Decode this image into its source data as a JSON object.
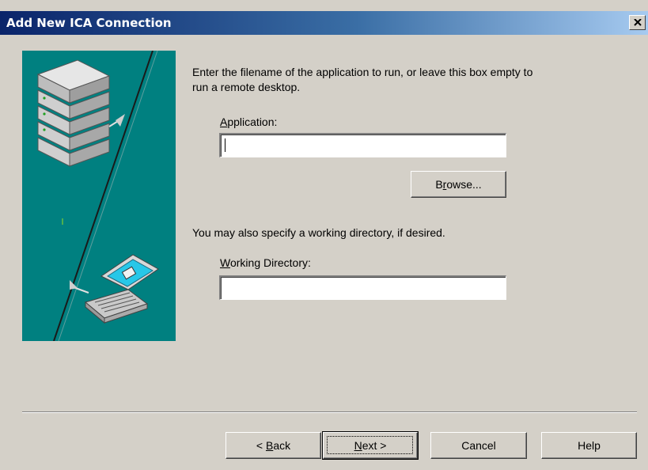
{
  "window": {
    "title": "Add New ICA Connection",
    "close_glyph": "×"
  },
  "main": {
    "instruction": "Enter the filename of the application to run, or leave this box empty to run a remote desktop.",
    "application_label_mnemonic": "A",
    "application_label_rest": "pplication:",
    "application_value": "",
    "browse_label_pre": "B",
    "browse_label_mnemonic": "r",
    "browse_label_post": "owse...",
    "working_dir_instruction": "You may also specify a working directory, if desired.",
    "working_dir_label_mnemonic": "W",
    "working_dir_label_rest": "orking Directory:",
    "working_dir_value": ""
  },
  "footer": {
    "back_prefix": "< ",
    "back_mnemonic": "B",
    "back_rest": "ack",
    "next_mnemonic": "N",
    "next_rest": "ext >",
    "cancel_label": "Cancel",
    "help_label": "Help"
  },
  "colors": {
    "title_gradient_start": "#0a246a",
    "title_gradient_end": "#a6caf0",
    "illustration_bg": "#008080",
    "dialog_bg": "#d4d0c8"
  },
  "icons": {
    "illustration": "server-to-laptop-illustration",
    "close": "close-icon"
  }
}
